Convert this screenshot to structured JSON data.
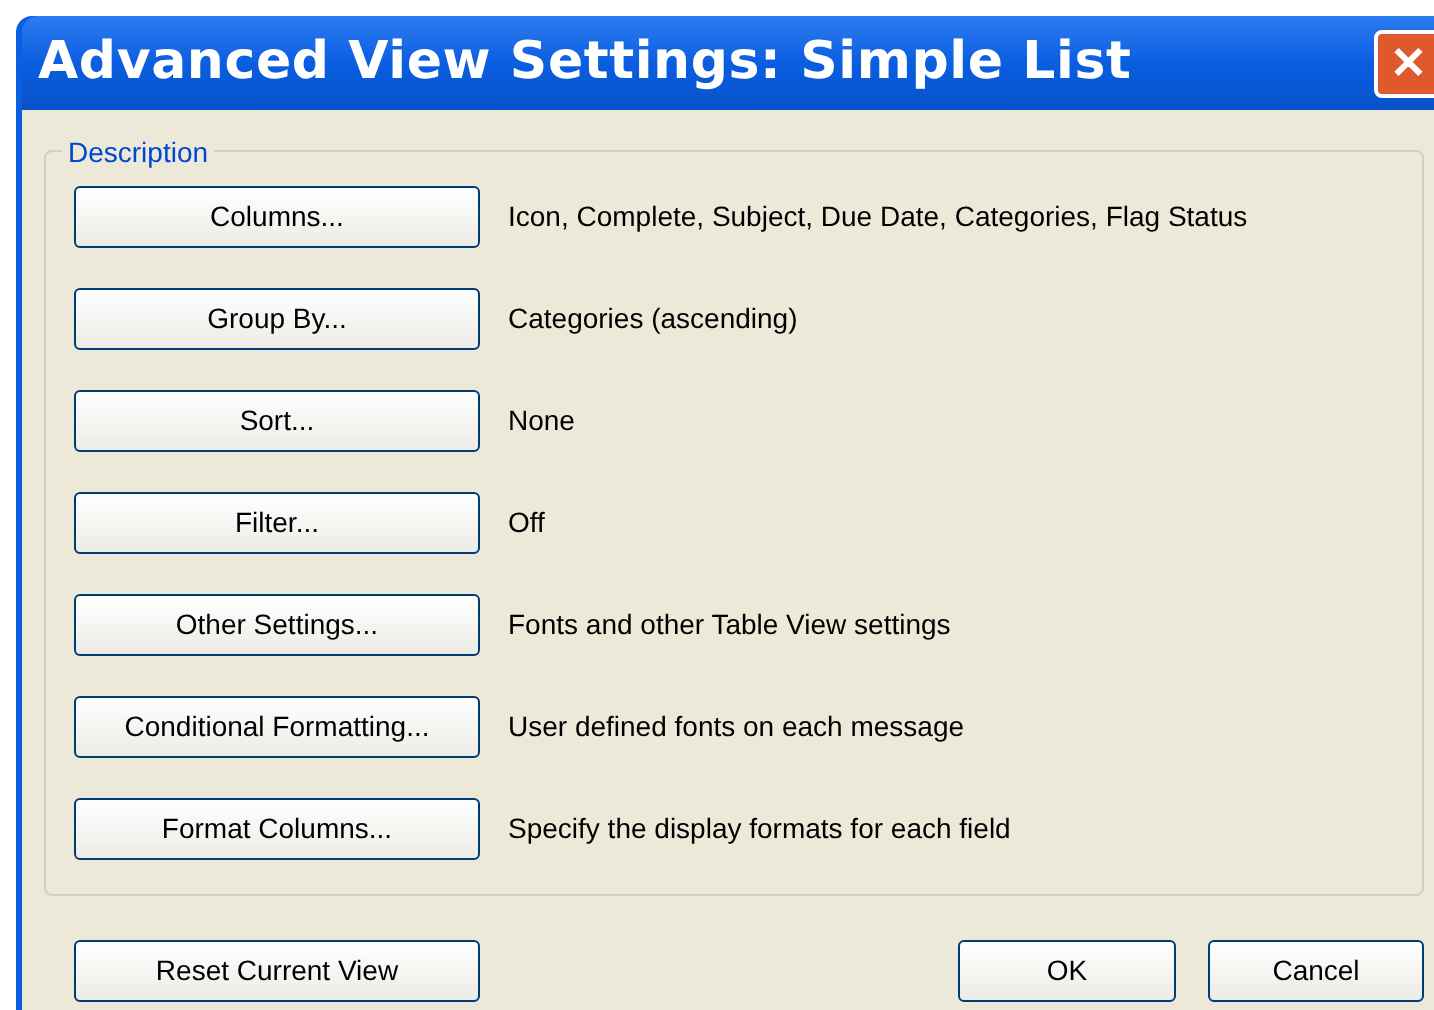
{
  "window": {
    "title": "Advanced View Settings: Simple List",
    "close": "✕"
  },
  "group": {
    "label": "Description",
    "rows": [
      {
        "button": "Columns...",
        "value": "Icon, Complete, Subject, Due Date, Categories, Flag Status"
      },
      {
        "button": "Group By...",
        "value": "Categories (ascending)"
      },
      {
        "button": "Sort...",
        "value": "None"
      },
      {
        "button": "Filter...",
        "value": "Off"
      },
      {
        "button": "Other Settings...",
        "value": "Fonts and other Table View settings"
      },
      {
        "button": "Conditional Formatting...",
        "value": "User defined fonts on each message"
      },
      {
        "button": "Format Columns...",
        "value": "Specify the display formats for each field"
      }
    ]
  },
  "buttons": {
    "reset": "Reset Current View",
    "ok": "OK",
    "cancel": "Cancel"
  }
}
